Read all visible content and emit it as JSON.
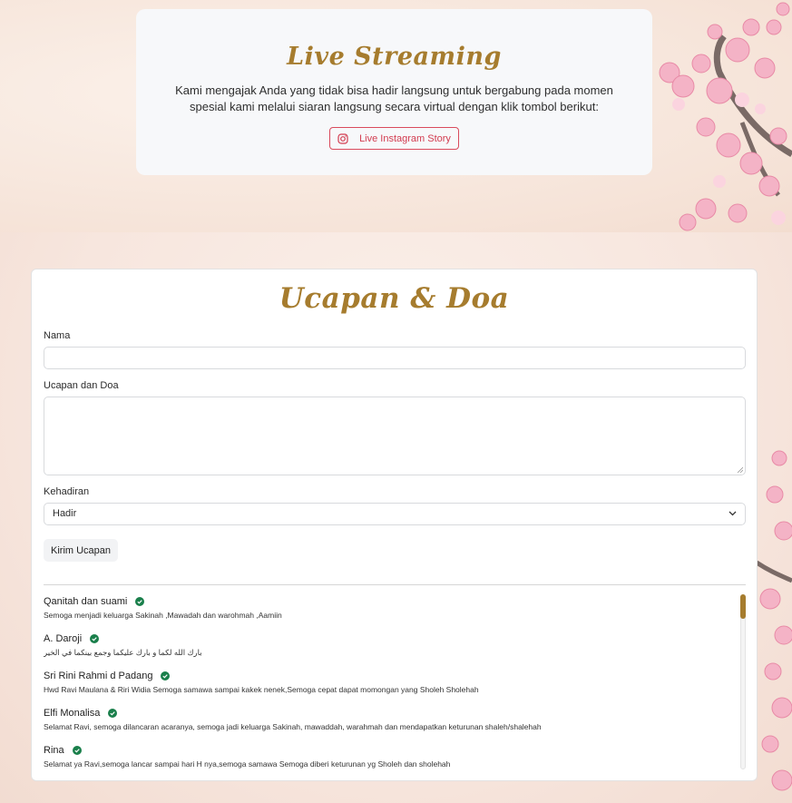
{
  "live": {
    "title": "Live Streaming",
    "text": "Kami mengajak Anda yang tidak bisa hadir langsung untuk bergabung pada momen spesial kami melalui siaran langsung secara virtual dengan klik tombol berikut:",
    "button_label": "Live Instagram Story",
    "button_icon": "instagram-icon"
  },
  "wishes": {
    "title": "Ucapan & Doa",
    "name_label": "Nama",
    "name_value": "",
    "message_label": "Ucapan dan Doa",
    "message_value": "",
    "attendance_label": "Kehadiran",
    "attendance_value": "Hadir",
    "submit_label": "Kirim Ucapan",
    "items": [
      {
        "name": "Qanitah dan suami",
        "message": "Semoga menjadi keluarga Sakinah ,Mawadah dan warohmah ,Aamiin"
      },
      {
        "name": "A. Daroji",
        "message": "بارك الله لكما و بارك عليكما وجمع بينكما في الخير"
      },
      {
        "name": "Sri Rini Rahmi d Padang",
        "message": "Hwd Ravi Maulana & Riri Widia Semoga samawa sampai kakek nenek,Semoga cepat dapat momongan yang Sholeh Sholehah"
      },
      {
        "name": "Elfi Monalisa",
        "message": "Selamat Ravi, semoga dilancaran acaranya, semoga jadi keluarga Sakinah, mawaddah, warahmah dan mendapatkan keturunan shaleh/shalehah"
      },
      {
        "name": "Rina",
        "message": "Selamat ya Ravi,semoga lancar sampai hari H nya,semoga samawa Semoga diberi keturunan yg Sholeh dan sholehah"
      }
    ]
  },
  "colors": {
    "accent_gold": "#a67c2e",
    "instagram_red": "#d23c50",
    "verified_green": "#1a7f4b",
    "blossom_pink": "#f2a7bd"
  }
}
